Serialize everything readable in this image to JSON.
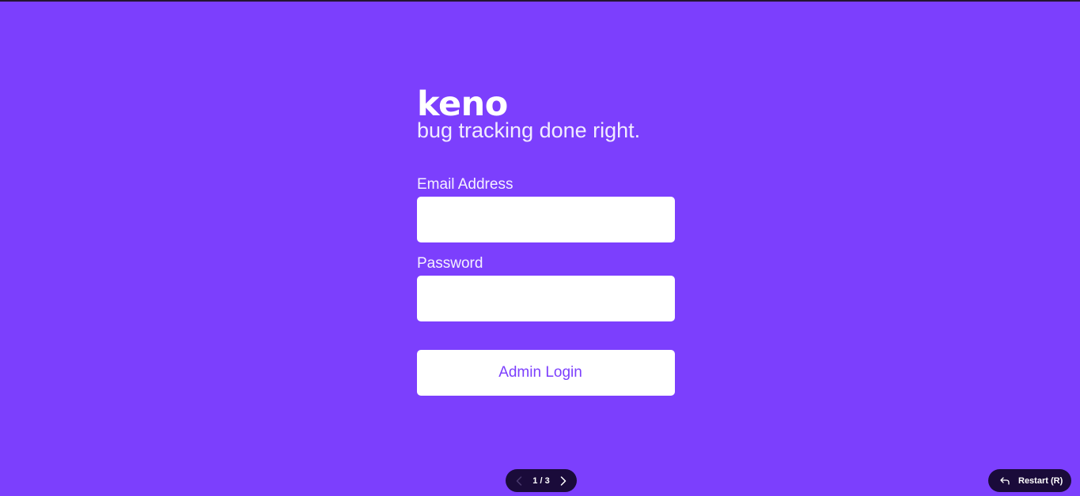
{
  "brand": {
    "logo_text": "keno",
    "tagline": "bug tracking done right."
  },
  "form": {
    "email_label": "Email Address",
    "email_value": "",
    "password_label": "Password",
    "password_value": "",
    "submit_label": "Admin Login"
  },
  "pager": {
    "count": "1 / 3",
    "prev_icon": "chevron-left-icon",
    "next_icon": "chevron-right-icon"
  },
  "restart": {
    "label": "Restart (R)",
    "icon": "undo-arrow-icon"
  },
  "colors": {
    "background": "#7c3ffd",
    "button_text": "#7c3ffd",
    "pill_background": "#1a0b3a"
  }
}
